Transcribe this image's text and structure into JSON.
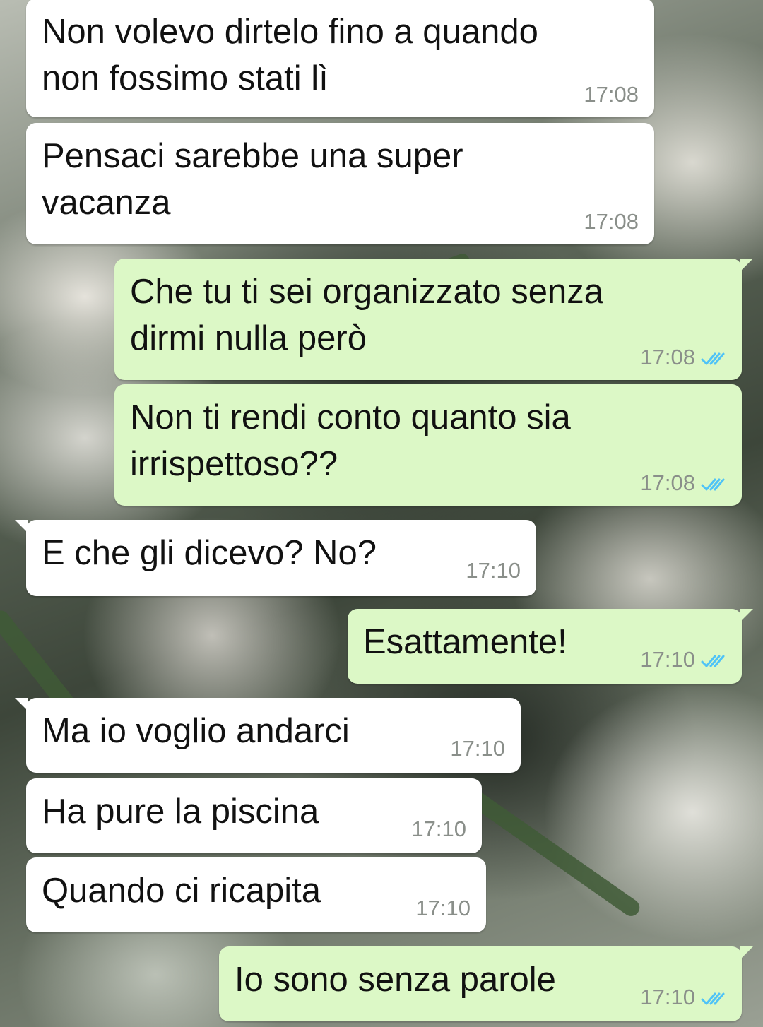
{
  "messages": [
    {
      "direction": "in",
      "text": "Non volevo dirtelo fino a quando\nnon fossimo stati lì",
      "time": "17:08"
    },
    {
      "direction": "in",
      "text": "Pensaci sarebbe una super\nvacanza",
      "time": "17:08"
    },
    {
      "direction": "out",
      "text": "Che tu ti sei organizzato senza\ndirmi nulla però",
      "time": "17:08",
      "status": "read"
    },
    {
      "direction": "out",
      "text": "Non ti rendi conto quanto sia\nirrispettoso??",
      "time": "17:08",
      "status": "read"
    },
    {
      "direction": "in",
      "text": "E che gli dicevo? No?",
      "time": "17:10"
    },
    {
      "direction": "out",
      "text": "Esattamente!",
      "time": "17:10",
      "status": "read"
    },
    {
      "direction": "in",
      "text": "Ma io voglio andarci",
      "time": "17:10"
    },
    {
      "direction": "in",
      "text": "Ha pure la piscina",
      "time": "17:10"
    },
    {
      "direction": "in",
      "text": "Quando ci ricapita",
      "time": "17:10"
    },
    {
      "direction": "out",
      "text": "Io sono senza parole",
      "time": "17:10",
      "status": "read"
    }
  ],
  "colors": {
    "incoming_bubble": "#ffffff",
    "outgoing_bubble": "#dcf8c6",
    "read_ticks": "#4fc3f7",
    "timestamp": "#8a8f8a"
  },
  "icons": {
    "read_receipt": "double-check-icon"
  }
}
